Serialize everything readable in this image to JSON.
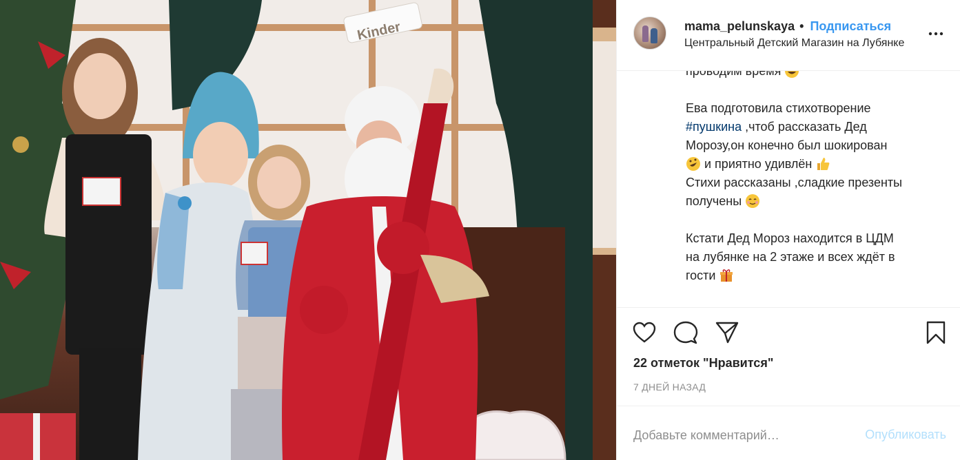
{
  "post": {
    "author": "mama_pelunskaya",
    "separator": "•",
    "follow_label": "Подписаться",
    "location": "Центральный Детский Магазин на Лубянке",
    "photo_sign_text": "Kinder"
  },
  "caption": {
    "line0": "проводим время",
    "line1": "Ева подготовила стихотворение",
    "hashtag": "#пушкина",
    "line2_rest": " ,чтоб рассказать Дед",
    "line3": "Морозу,он конечно был шокирован",
    "line4": " и приятно удивлён ",
    "line5": "Стихи рассказаны ,сладкие презенты",
    "line6": "получены ",
    "line7": "Кстати Дед Мороз находится в ЦДМ",
    "line8": "на лубянке на 2 этаже и всех ждёт в",
    "line9": "гости "
  },
  "actions": {
    "likes": "22 отметок \"Нравится\"",
    "date": "7 ДНЕЙ НАЗАД"
  },
  "comment": {
    "placeholder": "Добавьте комментарий…",
    "publish_label": "Опубликовать"
  },
  "colors": {
    "link_blue": "#3897f0",
    "hashtag_blue": "#00376b",
    "publish_disabled": "#b2dffc",
    "border": "#efefef",
    "muted_text": "#8e8e8e"
  },
  "icons": [
    "more-options-icon",
    "heart-icon",
    "comment-icon",
    "share-icon",
    "bookmark-icon",
    "emoji-laughing-icon",
    "emoji-rofl-icon",
    "emoji-thumbs-up-icon",
    "emoji-blushing-icon",
    "emoji-gift-icon"
  ]
}
